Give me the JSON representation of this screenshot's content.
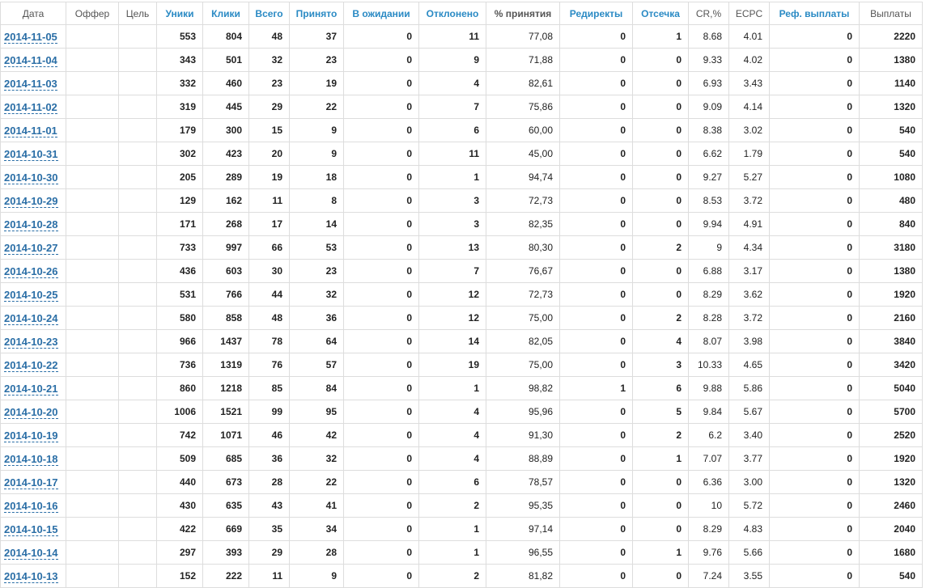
{
  "headers": {
    "date": "Дата",
    "offer": "Оффер",
    "goal": "Цель",
    "uniques": "Уники",
    "clicks": "Клики",
    "total": "Всего",
    "accepted": "Принято",
    "pending": "В ожидании",
    "rejected": "Отклонено",
    "accept_pct": "% принятия",
    "redirects": "Редиректы",
    "cutoff": "Отсечка",
    "cr": "CR,%",
    "ecpc": "ECPC",
    "ref_payouts": "Реф. выплаты",
    "payouts": "Выплаты"
  },
  "rows": [
    {
      "date": "2014-11-05",
      "offer": "",
      "goal": "",
      "uniques": "553",
      "clicks": "804",
      "total": "48",
      "accepted": "37",
      "pending": "0",
      "rejected": "11",
      "accept_pct": "77,08",
      "redirects": "0",
      "cutoff": "1",
      "cr": "8.68",
      "ecpc": "4.01",
      "ref_payouts": "0",
      "payouts": "2220"
    },
    {
      "date": "2014-11-04",
      "offer": "",
      "goal": "",
      "uniques": "343",
      "clicks": "501",
      "total": "32",
      "accepted": "23",
      "pending": "0",
      "rejected": "9",
      "accept_pct": "71,88",
      "redirects": "0",
      "cutoff": "0",
      "cr": "9.33",
      "ecpc": "4.02",
      "ref_payouts": "0",
      "payouts": "1380"
    },
    {
      "date": "2014-11-03",
      "offer": "",
      "goal": "",
      "uniques": "332",
      "clicks": "460",
      "total": "23",
      "accepted": "19",
      "pending": "0",
      "rejected": "4",
      "accept_pct": "82,61",
      "redirects": "0",
      "cutoff": "0",
      "cr": "6.93",
      "ecpc": "3.43",
      "ref_payouts": "0",
      "payouts": "1140"
    },
    {
      "date": "2014-11-02",
      "offer": "",
      "goal": "",
      "uniques": "319",
      "clicks": "445",
      "total": "29",
      "accepted": "22",
      "pending": "0",
      "rejected": "7",
      "accept_pct": "75,86",
      "redirects": "0",
      "cutoff": "0",
      "cr": "9.09",
      "ecpc": "4.14",
      "ref_payouts": "0",
      "payouts": "1320"
    },
    {
      "date": "2014-11-01",
      "offer": "",
      "goal": "",
      "uniques": "179",
      "clicks": "300",
      "total": "15",
      "accepted": "9",
      "pending": "0",
      "rejected": "6",
      "accept_pct": "60,00",
      "redirects": "0",
      "cutoff": "0",
      "cr": "8.38",
      "ecpc": "3.02",
      "ref_payouts": "0",
      "payouts": "540"
    },
    {
      "date": "2014-10-31",
      "offer": "",
      "goal": "",
      "uniques": "302",
      "clicks": "423",
      "total": "20",
      "accepted": "9",
      "pending": "0",
      "rejected": "11",
      "accept_pct": "45,00",
      "redirects": "0",
      "cutoff": "0",
      "cr": "6.62",
      "ecpc": "1.79",
      "ref_payouts": "0",
      "payouts": "540"
    },
    {
      "date": "2014-10-30",
      "offer": "",
      "goal": "",
      "uniques": "205",
      "clicks": "289",
      "total": "19",
      "accepted": "18",
      "pending": "0",
      "rejected": "1",
      "accept_pct": "94,74",
      "redirects": "0",
      "cutoff": "0",
      "cr": "9.27",
      "ecpc": "5.27",
      "ref_payouts": "0",
      "payouts": "1080"
    },
    {
      "date": "2014-10-29",
      "offer": "",
      "goal": "",
      "uniques": "129",
      "clicks": "162",
      "total": "11",
      "accepted": "8",
      "pending": "0",
      "rejected": "3",
      "accept_pct": "72,73",
      "redirects": "0",
      "cutoff": "0",
      "cr": "8.53",
      "ecpc": "3.72",
      "ref_payouts": "0",
      "payouts": "480"
    },
    {
      "date": "2014-10-28",
      "offer": "",
      "goal": "",
      "uniques": "171",
      "clicks": "268",
      "total": "17",
      "accepted": "14",
      "pending": "0",
      "rejected": "3",
      "accept_pct": "82,35",
      "redirects": "0",
      "cutoff": "0",
      "cr": "9.94",
      "ecpc": "4.91",
      "ref_payouts": "0",
      "payouts": "840"
    },
    {
      "date": "2014-10-27",
      "offer": "",
      "goal": "",
      "uniques": "733",
      "clicks": "997",
      "total": "66",
      "accepted": "53",
      "pending": "0",
      "rejected": "13",
      "accept_pct": "80,30",
      "redirects": "0",
      "cutoff": "2",
      "cr": "9",
      "ecpc": "4.34",
      "ref_payouts": "0",
      "payouts": "3180"
    },
    {
      "date": "2014-10-26",
      "offer": "",
      "goal": "",
      "uniques": "436",
      "clicks": "603",
      "total": "30",
      "accepted": "23",
      "pending": "0",
      "rejected": "7",
      "accept_pct": "76,67",
      "redirects": "0",
      "cutoff": "0",
      "cr": "6.88",
      "ecpc": "3.17",
      "ref_payouts": "0",
      "payouts": "1380"
    },
    {
      "date": "2014-10-25",
      "offer": "",
      "goal": "",
      "uniques": "531",
      "clicks": "766",
      "total": "44",
      "accepted": "32",
      "pending": "0",
      "rejected": "12",
      "accept_pct": "72,73",
      "redirects": "0",
      "cutoff": "0",
      "cr": "8.29",
      "ecpc": "3.62",
      "ref_payouts": "0",
      "payouts": "1920"
    },
    {
      "date": "2014-10-24",
      "offer": "",
      "goal": "",
      "uniques": "580",
      "clicks": "858",
      "total": "48",
      "accepted": "36",
      "pending": "0",
      "rejected": "12",
      "accept_pct": "75,00",
      "redirects": "0",
      "cutoff": "2",
      "cr": "8.28",
      "ecpc": "3.72",
      "ref_payouts": "0",
      "payouts": "2160"
    },
    {
      "date": "2014-10-23",
      "offer": "",
      "goal": "",
      "uniques": "966",
      "clicks": "1437",
      "total": "78",
      "accepted": "64",
      "pending": "0",
      "rejected": "14",
      "accept_pct": "82,05",
      "redirects": "0",
      "cutoff": "4",
      "cr": "8.07",
      "ecpc": "3.98",
      "ref_payouts": "0",
      "payouts": "3840"
    },
    {
      "date": "2014-10-22",
      "offer": "",
      "goal": "",
      "uniques": "736",
      "clicks": "1319",
      "total": "76",
      "accepted": "57",
      "pending": "0",
      "rejected": "19",
      "accept_pct": "75,00",
      "redirects": "0",
      "cutoff": "3",
      "cr": "10.33",
      "ecpc": "4.65",
      "ref_payouts": "0",
      "payouts": "3420"
    },
    {
      "date": "2014-10-21",
      "offer": "",
      "goal": "",
      "uniques": "860",
      "clicks": "1218",
      "total": "85",
      "accepted": "84",
      "pending": "0",
      "rejected": "1",
      "accept_pct": "98,82",
      "redirects": "1",
      "cutoff": "6",
      "cr": "9.88",
      "ecpc": "5.86",
      "ref_payouts": "0",
      "payouts": "5040"
    },
    {
      "date": "2014-10-20",
      "offer": "",
      "goal": "",
      "uniques": "1006",
      "clicks": "1521",
      "total": "99",
      "accepted": "95",
      "pending": "0",
      "rejected": "4",
      "accept_pct": "95,96",
      "redirects": "0",
      "cutoff": "5",
      "cr": "9.84",
      "ecpc": "5.67",
      "ref_payouts": "0",
      "payouts": "5700"
    },
    {
      "date": "2014-10-19",
      "offer": "",
      "goal": "",
      "uniques": "742",
      "clicks": "1071",
      "total": "46",
      "accepted": "42",
      "pending": "0",
      "rejected": "4",
      "accept_pct": "91,30",
      "redirects": "0",
      "cutoff": "2",
      "cr": "6.2",
      "ecpc": "3.40",
      "ref_payouts": "0",
      "payouts": "2520"
    },
    {
      "date": "2014-10-18",
      "offer": "",
      "goal": "",
      "uniques": "509",
      "clicks": "685",
      "total": "36",
      "accepted": "32",
      "pending": "0",
      "rejected": "4",
      "accept_pct": "88,89",
      "redirects": "0",
      "cutoff": "1",
      "cr": "7.07",
      "ecpc": "3.77",
      "ref_payouts": "0",
      "payouts": "1920"
    },
    {
      "date": "2014-10-17",
      "offer": "",
      "goal": "",
      "uniques": "440",
      "clicks": "673",
      "total": "28",
      "accepted": "22",
      "pending": "0",
      "rejected": "6",
      "accept_pct": "78,57",
      "redirects": "0",
      "cutoff": "0",
      "cr": "6.36",
      "ecpc": "3.00",
      "ref_payouts": "0",
      "payouts": "1320"
    },
    {
      "date": "2014-10-16",
      "offer": "",
      "goal": "",
      "uniques": "430",
      "clicks": "635",
      "total": "43",
      "accepted": "41",
      "pending": "0",
      "rejected": "2",
      "accept_pct": "95,35",
      "redirects": "0",
      "cutoff": "0",
      "cr": "10",
      "ecpc": "5.72",
      "ref_payouts": "0",
      "payouts": "2460"
    },
    {
      "date": "2014-10-15",
      "offer": "",
      "goal": "",
      "uniques": "422",
      "clicks": "669",
      "total": "35",
      "accepted": "34",
      "pending": "0",
      "rejected": "1",
      "accept_pct": "97,14",
      "redirects": "0",
      "cutoff": "0",
      "cr": "8.29",
      "ecpc": "4.83",
      "ref_payouts": "0",
      "payouts": "2040"
    },
    {
      "date": "2014-10-14",
      "offer": "",
      "goal": "",
      "uniques": "297",
      "clicks": "393",
      "total": "29",
      "accepted": "28",
      "pending": "0",
      "rejected": "1",
      "accept_pct": "96,55",
      "redirects": "0",
      "cutoff": "1",
      "cr": "9.76",
      "ecpc": "5.66",
      "ref_payouts": "0",
      "payouts": "1680"
    },
    {
      "date": "2014-10-13",
      "offer": "",
      "goal": "",
      "uniques": "152",
      "clicks": "222",
      "total": "11",
      "accepted": "9",
      "pending": "0",
      "rejected": "2",
      "accept_pct": "81,82",
      "redirects": "0",
      "cutoff": "0",
      "cr": "7.24",
      "ecpc": "3.55",
      "ref_payouts": "0",
      "payouts": "540"
    }
  ]
}
